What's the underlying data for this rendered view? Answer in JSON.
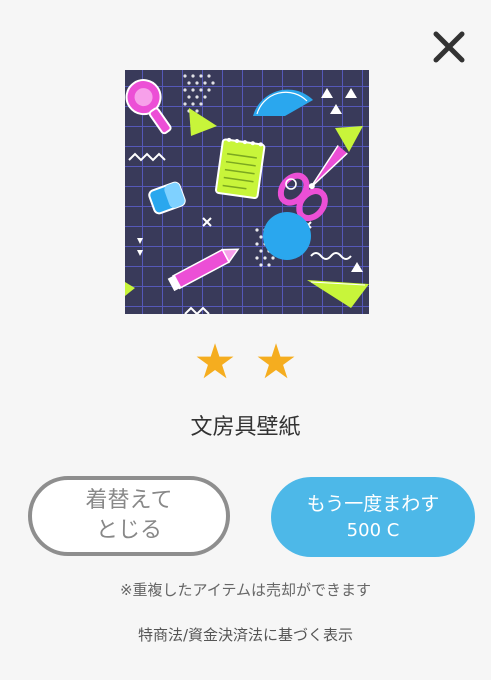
{
  "modal": {
    "close_icon": "close-icon",
    "item": {
      "image_alt": "stationery-pattern",
      "rarity_stars": 2,
      "star_glyph": "★",
      "name": "文房具壁紙"
    },
    "buttons": {
      "dress_close_label": "着替えて\nとじる",
      "spin_again_label": "もう一度まわす",
      "spin_again_price": "500 C"
    },
    "note": "※重複したアイテムは売却ができます",
    "legal_link": "特商法/資金決済法に基づく表示"
  },
  "colors": {
    "background": "#f6f6f6",
    "star": "#f5ad1f",
    "primary_button": "#4db8e8",
    "outline_button_border": "#8e8e8e",
    "pattern_bg": "#393a5a",
    "pattern_magenta": "#ec4fd6",
    "pattern_lime": "#c8f53a",
    "pattern_blue": "#2aa7ee"
  }
}
